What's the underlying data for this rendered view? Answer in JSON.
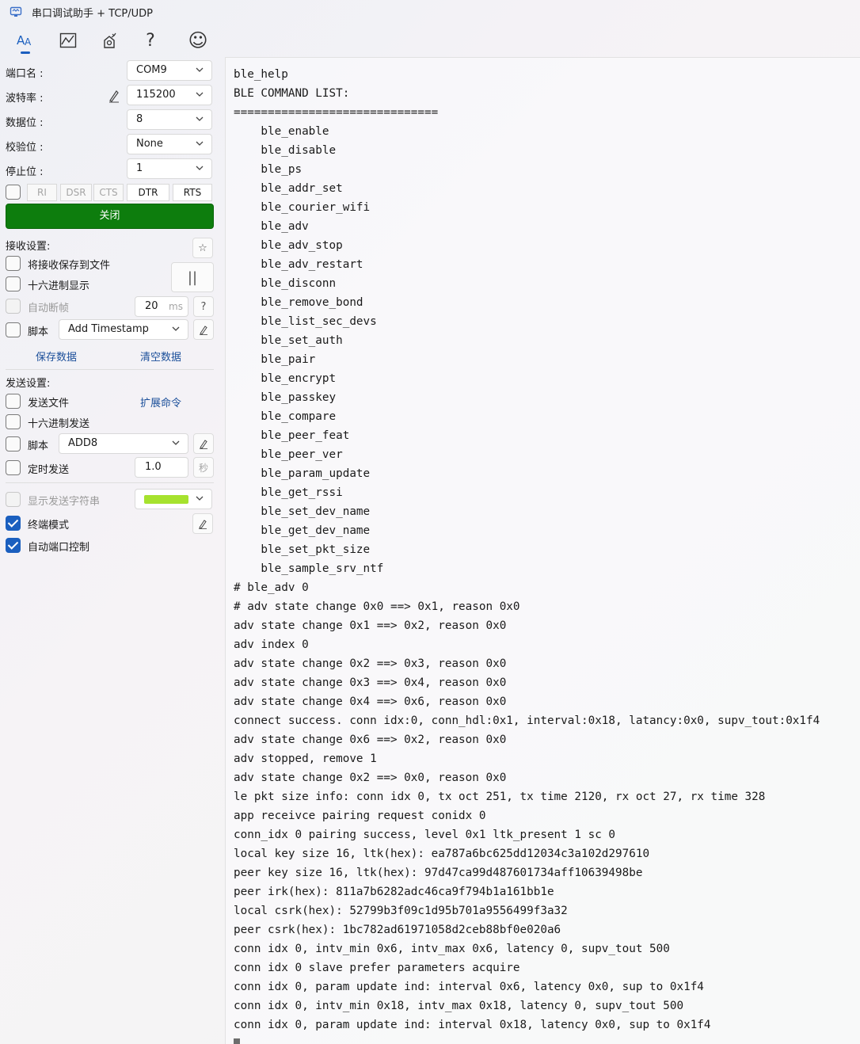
{
  "window": {
    "title": "串口调试助手 + TCP/UDP"
  },
  "toolbar": {
    "items": [
      {
        "icon": "font-icon"
      },
      {
        "icon": "chart-icon"
      },
      {
        "icon": "settings-icon"
      },
      {
        "icon": "help-icon",
        "glyph": "?"
      },
      {
        "icon": "smiley-icon",
        "glyph": "☺"
      }
    ]
  },
  "port": {
    "port_label": "端口名 :",
    "port_value": "COM9",
    "baud_label": "波特率 :",
    "baud_value": "115200",
    "data_bits_label": "数据位 :",
    "data_bits_value": "8",
    "parity_label": "校验位 :",
    "parity_value": "None",
    "stop_bits_label": "停止位 :",
    "stop_bits_value": "1",
    "signals": [
      "RI",
      "DSR",
      "CTS",
      "DTR",
      "RTS"
    ],
    "close_label": "关闭"
  },
  "receive": {
    "section_label": "接收设置:",
    "save_to_file_label": "将接收保存到文件",
    "hex_display_label": "十六进制显示",
    "auto_frame_label": "自动断帧",
    "auto_frame_value": "20",
    "auto_frame_unit": "ms",
    "help_glyph": "?",
    "script_label": "脚本",
    "script_value": "Add Timestamp",
    "pause_glyph": "||",
    "star_glyph": "☆",
    "save_data_label": "保存数据",
    "clear_data_label": "清空数据"
  },
  "send": {
    "section_label": "发送设置:",
    "send_file_label": "发送文件",
    "ext_cmd_label": "扩展命令",
    "hex_send_label": "十六进制发送",
    "script_label": "脚本",
    "script_value": "ADD8",
    "timed_send_label": "定时发送",
    "timed_value": "1.0",
    "timed_unit": "秒",
    "show_send_label": "显示发送字符串",
    "show_send_color": "#a6e22e",
    "terminal_mode_label": "终端模式",
    "auto_port_ctrl_label": "自动端口控制"
  },
  "terminal": {
    "lines": [
      "ble_help",
      "BLE COMMAND LIST:",
      "==============================",
      "    ble_enable",
      "    ble_disable",
      "    ble_ps",
      "    ble_addr_set",
      "    ble_courier_wifi",
      "    ble_adv",
      "    ble_adv_stop",
      "    ble_adv_restart",
      "    ble_disconn",
      "    ble_remove_bond",
      "    ble_list_sec_devs",
      "    ble_set_auth",
      "    ble_pair",
      "    ble_encrypt",
      "    ble_passkey",
      "    ble_compare",
      "    ble_peer_feat",
      "    ble_peer_ver",
      "    ble_param_update",
      "    ble_get_rssi",
      "    ble_set_dev_name",
      "    ble_get_dev_name",
      "    ble_set_pkt_size",
      "    ble_sample_srv_ntf",
      "# ble_adv 0",
      "# adv state change 0x0 ==> 0x1, reason 0x0",
      "adv state change 0x1 ==> 0x2, reason 0x0",
      "adv index 0",
      "adv state change 0x2 ==> 0x3, reason 0x0",
      "adv state change 0x3 ==> 0x4, reason 0x0",
      "adv state change 0x4 ==> 0x6, reason 0x0",
      "connect success. conn idx:0, conn_hdl:0x1, interval:0x18, latancy:0x0, supv_tout:0x1f4",
      "adv state change 0x6 ==> 0x2, reason 0x0",
      "adv stopped, remove 1",
      "adv state change 0x2 ==> 0x0, reason 0x0",
      "le pkt size info: conn idx 0, tx oct 251, tx time 2120, rx oct 27, rx time 328",
      "app receivce pairing request conidx 0",
      "conn_idx 0 pairing success, level 0x1 ltk_present 1 sc 0",
      "local key size 16, ltk(hex): ea787a6bc625dd12034c3a102d297610",
      "peer key size 16, ltk(hex): 97d47ca99d487601734aff10639498be",
      "peer irk(hex): 811a7b6282adc46ca9f794b1a161bb1e",
      "local csrk(hex): 52799b3f09c1d95b701a9556499f3a32",
      "peer csrk(hex): 1bc782ad61971058d2ceb88bf0e020a6",
      "conn idx 0, intv_min 0x6, intv_max 0x6, latency 0, supv_tout 500",
      "conn idx 0 slave prefer parameters acquire",
      "conn idx 0, param update ind: interval 0x6, latency 0x0, sup to 0x1f4",
      "conn idx 0, intv_min 0x18, intv_max 0x18, latency 0, supv_tout 500",
      "conn idx 0, param update ind: interval 0x18, latency 0x0, sup to 0x1f4"
    ]
  }
}
